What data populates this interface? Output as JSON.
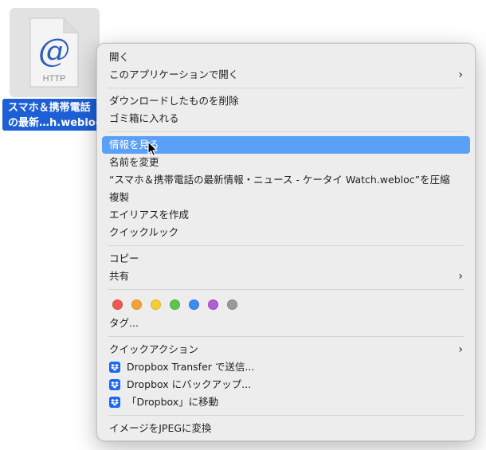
{
  "file": {
    "icon_label": "HTTP",
    "icon_glyph": "@",
    "name_line1": "スマホ＆携帯電話",
    "name_line2": "の最新…h.webloc"
  },
  "menu": {
    "open": "開く",
    "open_with": "このアプリケーションで開く",
    "delete_downloaded": "ダウンロードしたものを削除",
    "move_to_trash": "ゴミ箱に入れる",
    "get_info": "情報を見る",
    "rename": "名前を変更",
    "compress": "“スマホ＆携帯電話の最新情報・ニュース - ケータイ Watch.webloc”を圧縮",
    "duplicate": "複製",
    "make_alias": "エイリアスを作成",
    "quick_look": "クイックルック",
    "copy": "コピー",
    "share": "共有",
    "tags_label": "タグ...",
    "quick_actions": "クイックアクション",
    "dropbox_transfer": "Dropbox Transfer で送信...",
    "dropbox_backup": "Dropbox にバックアップ...",
    "dropbox_move": "「Dropbox」に移動",
    "convert_jpeg": "イメージをJPEGに変換"
  },
  "tag_colors": [
    {
      "name": "red",
      "fill": "#ec5a52",
      "stroke": "#d94a43"
    },
    {
      "name": "orange",
      "fill": "#f5a235",
      "stroke": "#e08f27"
    },
    {
      "name": "yellow",
      "fill": "#f6cb36",
      "stroke": "#e0b528"
    },
    {
      "name": "green",
      "fill": "#5ec451",
      "stroke": "#4aae3e"
    },
    {
      "name": "blue",
      "fill": "#3f8cf0",
      "stroke": "#2f77d8"
    },
    {
      "name": "purple",
      "fill": "#b15fd4",
      "stroke": "#9a4ac0"
    },
    {
      "name": "gray",
      "fill": "#9a9a9a",
      "stroke": "#858585"
    }
  ],
  "colors": {
    "selection": "#5aa0f6",
    "filename_highlight": "#1c5fd6",
    "dropbox": "#1c67f5"
  }
}
